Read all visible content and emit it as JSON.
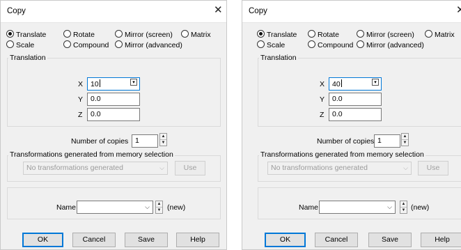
{
  "dialogs": [
    {
      "title": "Copy",
      "close_glyph": "✕",
      "modes": {
        "translate": "Translate",
        "rotate": "Rotate",
        "mirror_screen": "Mirror (screen)",
        "matrix": "Matrix",
        "scale": "Scale",
        "compound": "Compound",
        "mirror_advanced": "Mirror (advanced)",
        "selected": "translate"
      },
      "translation": {
        "group_label": "Translation",
        "x_label": "X",
        "x_value": "10",
        "y_label": "Y",
        "y_value": "0.0",
        "z_label": "Z",
        "z_value": "0.0"
      },
      "copies": {
        "label": "Number of copies",
        "value": "1"
      },
      "memory": {
        "group_label": "Transformations generated from memory selection",
        "combo_value": "No transformations generated",
        "use_label": "Use"
      },
      "name": {
        "label": "Name",
        "value": "",
        "status": "(new)"
      },
      "buttons": {
        "ok": "OK",
        "cancel": "Cancel",
        "save": "Save",
        "help": "Help"
      }
    },
    {
      "title": "Copy",
      "close_glyph": "✕",
      "modes": {
        "translate": "Translate",
        "rotate": "Rotate",
        "mirror_screen": "Mirror (screen)",
        "matrix": "Matrix",
        "scale": "Scale",
        "compound": "Compound",
        "mirror_advanced": "Mirror (advanced)",
        "selected": "translate"
      },
      "translation": {
        "group_label": "Translation",
        "x_label": "X",
        "x_value": "40",
        "y_label": "Y",
        "y_value": "0.0",
        "z_label": "Z",
        "z_value": "0.0"
      },
      "copies": {
        "label": "Number of copies",
        "value": "1"
      },
      "memory": {
        "group_label": "Transformations generated from memory selection",
        "combo_value": "No transformations generated",
        "use_label": "Use"
      },
      "name": {
        "label": "Name",
        "value": "",
        "status": "(new)"
      },
      "buttons": {
        "ok": "OK",
        "cancel": "Cancel",
        "save": "Save",
        "help": "Help"
      }
    }
  ],
  "icons": {
    "close": "close-icon",
    "cell_picker": "cell-picker-icon",
    "spin_up": "spin-up-icon",
    "spin_down": "spin-down-icon",
    "dropdown": "chevron-down-icon"
  },
  "colors": {
    "dialog_bg": "#f0f0f0",
    "titlebar_bg": "#ffffff",
    "accent": "#0078d7",
    "disabled_text": "#9b9b9b"
  }
}
